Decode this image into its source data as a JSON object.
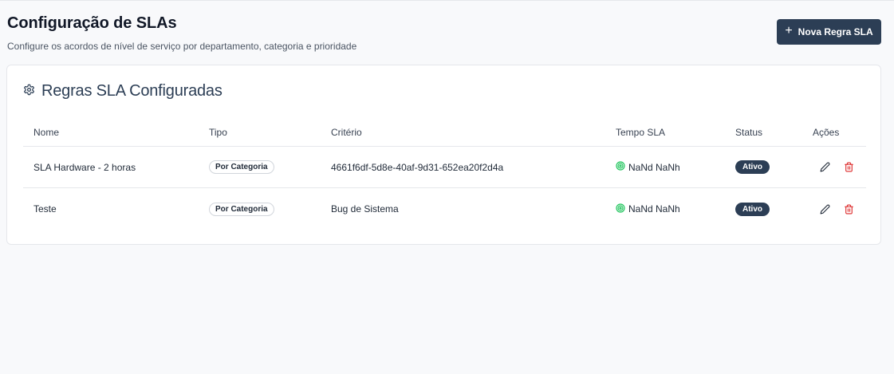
{
  "header": {
    "title": "Configuração de SLAs",
    "subtitle": "Configure os acordos de nível de serviço por departamento, categoria e prioridade",
    "new_button_label": "Nova Regra SLA"
  },
  "card": {
    "title": "Regras SLA Configuradas"
  },
  "table": {
    "columns": {
      "nome": "Nome",
      "tipo": "Tipo",
      "criterio": "Critério",
      "tempo": "Tempo SLA",
      "status": "Status",
      "acoes": "Ações"
    },
    "rows": [
      {
        "nome": "SLA Hardware - 2 horas",
        "tipo": "Por Categoria",
        "criterio": "4661f6df-5d8e-40af-9d31-652ea20f2d4a",
        "tempo": "NaNd NaNh",
        "status": "Ativo"
      },
      {
        "nome": "Teste",
        "tipo": "Por Categoria",
        "criterio": "Bug de Sistema",
        "tempo": "NaNd NaNh",
        "status": "Ativo"
      }
    ]
  },
  "colors": {
    "primary": "#2c3e55",
    "delete": "#dc2626",
    "tempo_icon": "#22c55e"
  },
  "icons": {
    "new_button": "plus-icon",
    "card_title": "gear-icon",
    "tempo": "target-icon",
    "edit": "pencil-icon",
    "delete": "trash-icon"
  }
}
